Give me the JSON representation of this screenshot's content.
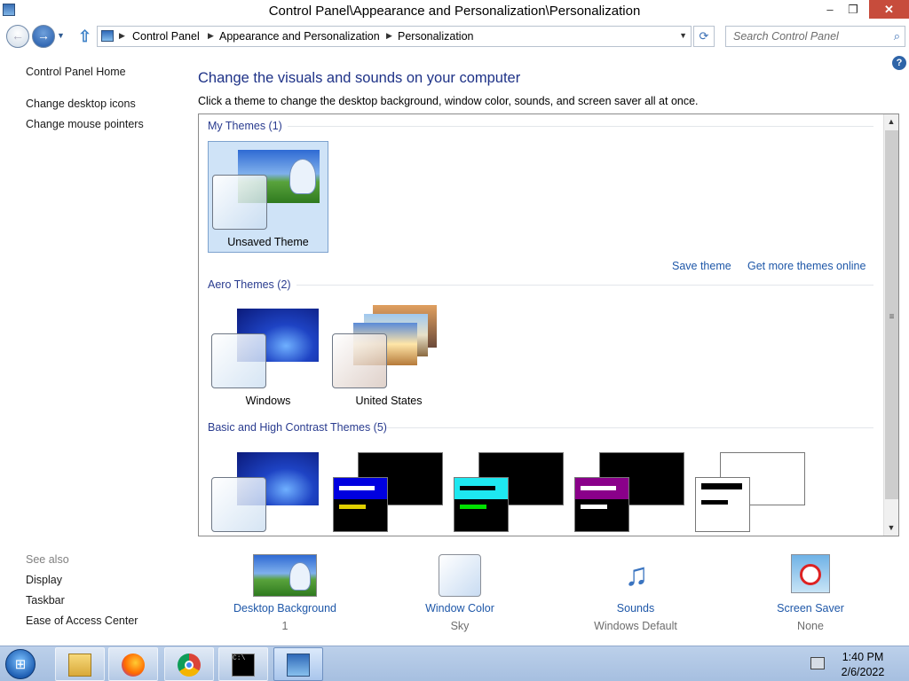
{
  "window": {
    "title": "Control Panel\\Appearance and Personalization\\Personalization",
    "minimize": "–",
    "maximize": "❐",
    "close": "✕"
  },
  "address": {
    "crumbs": [
      "Control Panel",
      "Appearance and Personalization",
      "Personalization"
    ],
    "search_placeholder": "Search Control Panel"
  },
  "sidebar": {
    "home": "Control Panel Home",
    "tasks": [
      "Change desktop icons",
      "Change mouse pointers"
    ],
    "see_also_heading": "See also",
    "see_also": [
      "Display",
      "Taskbar",
      "Ease of Access Center"
    ]
  },
  "main": {
    "help": "?",
    "heading": "Change the visuals and sounds on your computer",
    "subtext": "Click a theme to change the desktop background, window color, sounds, and screen saver all at once.",
    "groups": {
      "my": "My Themes (1)",
      "aero": "Aero Themes (2)",
      "basic": "Basic and High Contrast Themes (5)"
    },
    "my_themes": [
      {
        "name": "Unsaved Theme",
        "selected": true
      }
    ],
    "aero_themes": [
      {
        "name": "Windows"
      },
      {
        "name": "United States"
      }
    ],
    "links": {
      "save": "Save theme",
      "more": "Get more themes online"
    }
  },
  "bottom": [
    {
      "label": "Desktop Background",
      "value": "1",
      "icon": "desktop-background-icon"
    },
    {
      "label": "Window Color",
      "value": "Sky",
      "icon": "window-color-icon"
    },
    {
      "label": "Sounds",
      "value": "Windows Default",
      "icon": "sounds-icon"
    },
    {
      "label": "Screen Saver",
      "value": "None",
      "icon": "screen-saver-icon"
    }
  ],
  "taskbar": {
    "time": "1:40 PM",
    "date": "2/6/2022",
    "apps": [
      "file-explorer-icon",
      "firefox-icon",
      "chrome-icon",
      "cmd-icon",
      "control-panel-icon"
    ]
  },
  "colors": {
    "heading": "#1e3287",
    "link": "#1e57a8",
    "group": "#2a3c8f",
    "selected_bg": "#cfe3f7",
    "close_btn": "#c74c3c"
  }
}
